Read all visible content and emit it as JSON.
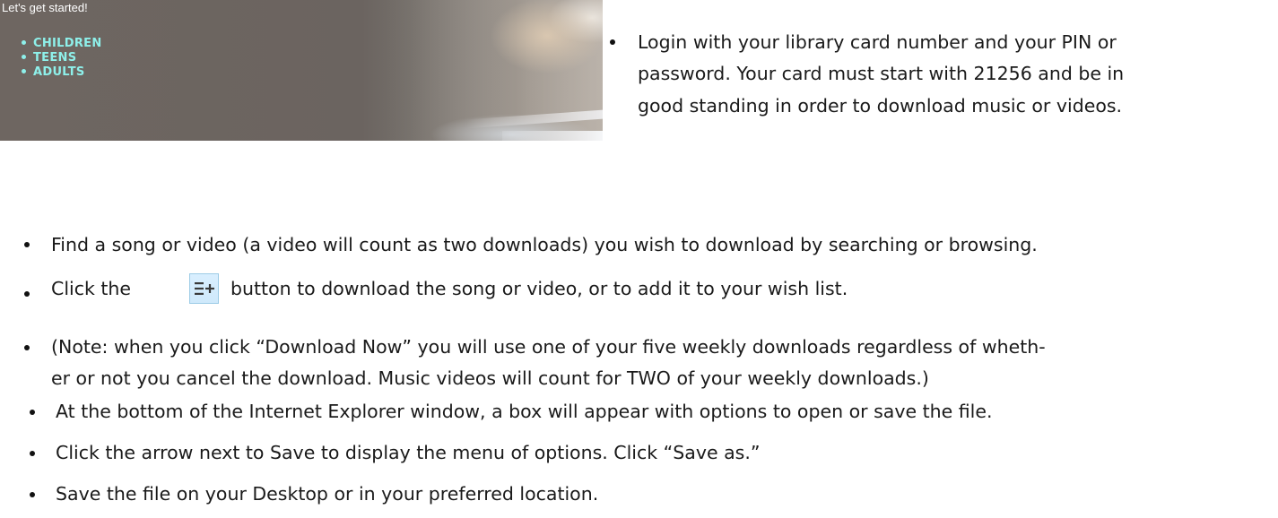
{
  "banner": {
    "title": "Let's get started!",
    "items": [
      "CHILDREN",
      "TEENS",
      "ADULTS"
    ]
  },
  "instructions": {
    "login_line1": "Login with your library card number and your PIN or",
    "login_line2": "password.  Your card must start with 21256 and be in",
    "login_line3": "good standing in order to download music or videos.",
    "find": "Find a song or video (a video will count as two downloads) you wish to download by searching or browsing.",
    "click_before": "Click the",
    "click_after": "button to download the song or video, or to add it to your wish list.",
    "note_line1": "(Note: when you click “Download Now” you will use one of your five weekly downloads regardless of wheth-",
    "note_line2": "er or not you cancel the download.  Music videos will count for TWO of your weekly downloads.)",
    "ie_box": "At the bottom of the Internet Explorer window, a box will appear with options to open or save the file.",
    "arrow": "Click the arrow next to Save to display the menu of options. Click “Save as.”",
    "save": "Save the file on your Desktop or in your preferred location."
  },
  "icons": {
    "add_button_icon": "list-add-icon"
  },
  "colors": {
    "banner_link": "#8ef0ea",
    "button_bg": "#d4ecfd",
    "button_border": "#9ccbe6",
    "icon_color": "#3a3a3a"
  }
}
